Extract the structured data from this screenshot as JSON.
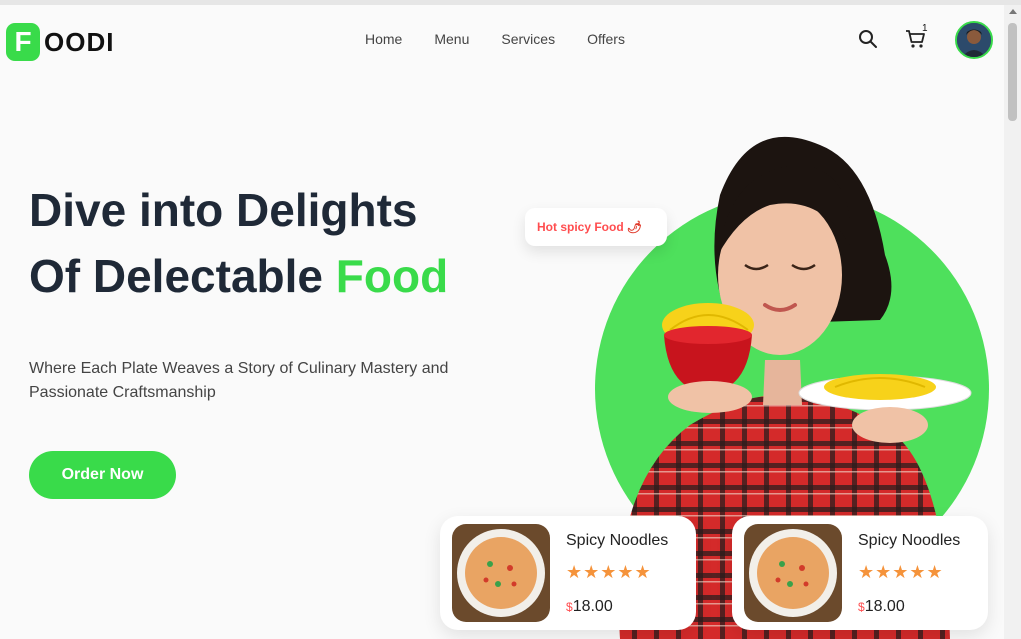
{
  "brand": {
    "logo_letter": "F",
    "logo_text": "OODI",
    "accent": "#39db4a"
  },
  "nav": {
    "items": [
      "Home",
      "Menu",
      "Services",
      "Offers"
    ]
  },
  "header": {
    "cart_count": "1"
  },
  "hero": {
    "line1": "Dive into Delights",
    "line2_prefix": "Of Delectable ",
    "line2_highlight": "Food",
    "subtitle": "Where Each Plate Weaves a Story of Culinary Mastery and Passionate Craftsmanship",
    "cta": "Order Now",
    "bubble": "Hot spicy Food",
    "bubble_icon": "🌶"
  },
  "cards": [
    {
      "title": "Spicy Noodles",
      "rating": 5,
      "stars": "★★★★★",
      "currency": "$",
      "price": "18.00"
    },
    {
      "title": "Spicy Noodles",
      "rating": 5,
      "stars": "★★★★★",
      "currency": "$",
      "price": "18.00"
    }
  ],
  "colors": {
    "accent": "#39db4a",
    "price_sign": "#ff4d4f",
    "star": "#f5933b",
    "heading": "#1f2937"
  }
}
